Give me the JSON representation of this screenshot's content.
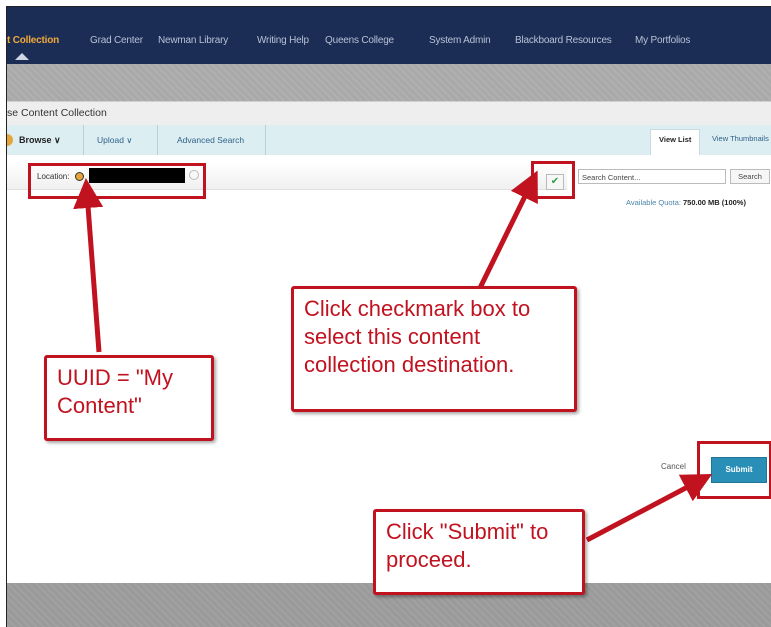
{
  "topnav": {
    "tabs": [
      {
        "label": "t Collection",
        "active": true
      },
      {
        "label": "Grad Center"
      },
      {
        "label": "Newman Library"
      },
      {
        "label": "Writing Help"
      },
      {
        "label": "Queens College"
      },
      {
        "label": "System Admin"
      },
      {
        "label": "Blackboard Resources"
      },
      {
        "label": "My Portfolios"
      }
    ]
  },
  "titlebar": {
    "title": "se Content Collection"
  },
  "toolbar": {
    "browse": "Browse ∨",
    "upload": "Upload ∨",
    "advanced_search": "Advanced Search",
    "view_list": "View List",
    "view_thumbnails": "View Thumbnails"
  },
  "content": {
    "location_label": "Location:",
    "search_placeholder": "Search Content...",
    "search_button": "Search",
    "quota_label": "Available Quota:",
    "quota_value": "750.00 MB (100%)",
    "cancel": "Cancel",
    "submit": "Submit"
  },
  "annotations": {
    "checkmark_callout": "Click checkmark box to select this content collection destination.",
    "uuid_callout": "UUID = \"My Content\"",
    "submit_callout": "Click \"Submit\" to proceed."
  },
  "colors": {
    "nav_bg": "#1b2d55",
    "active_tab": "#f1a93b",
    "toolbar_bg": "#dceef2",
    "submit_bg": "#2a8fb7",
    "annotation_red": "#c1121f"
  }
}
